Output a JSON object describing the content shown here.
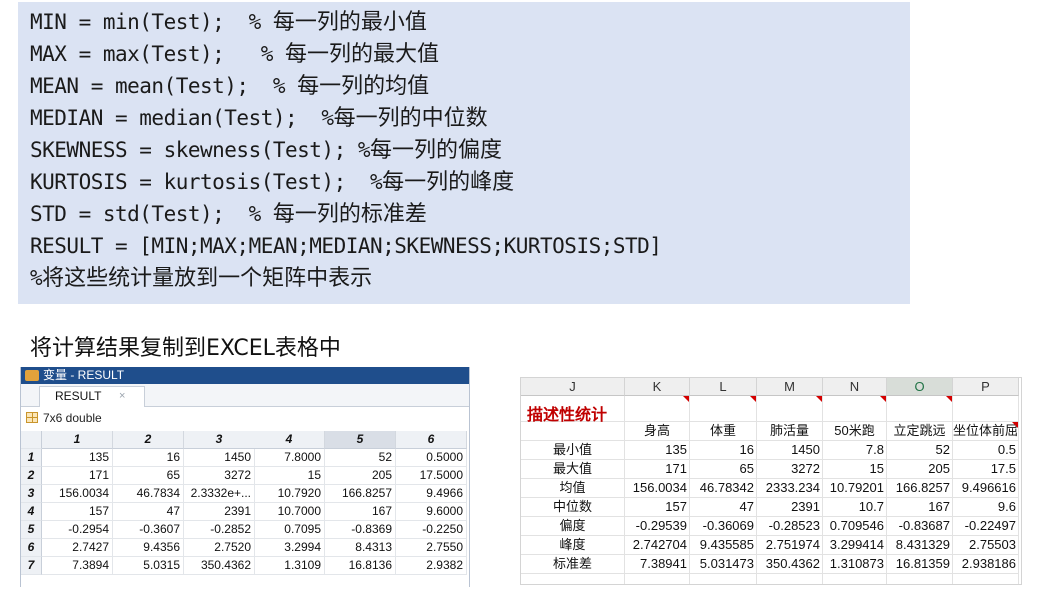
{
  "code_lines": [
    {
      "code": "MIN = min(Test);  % ",
      "comment": "每一列的最小值"
    },
    {
      "code": "MAX = max(Test);   % ",
      "comment": "每一列的最大值"
    },
    {
      "code": "MEAN = mean(Test);  % ",
      "comment": "每一列的均值"
    },
    {
      "code": "MEDIAN = median(Test);  %",
      "comment": "每一列的中位数"
    },
    {
      "code": "SKEWNESS = skewness(Test); %",
      "comment": "每一列的偏度"
    },
    {
      "code": "KURTOSIS = kurtosis(Test);  %",
      "comment": "每一列的峰度"
    },
    {
      "code": "STD = std(Test);  % ",
      "comment": "每一列的标准差"
    },
    {
      "code": "RESULT = [MIN;MAX;MEAN;MEDIAN;SKEWNESS;KURTOSIS;STD]",
      "comment": ""
    },
    {
      "code": "%",
      "comment": "将这些统计量放到一个矩阵中表示"
    }
  ],
  "caption": "将计算结果复制到EXCEL表格中",
  "matlab": {
    "window_title": "变量 - RESULT",
    "tab_label": "RESULT",
    "tab_close": "×",
    "dimension": "7x6 double",
    "col_headers": [
      "1",
      "2",
      "3",
      "4",
      "5",
      "6"
    ],
    "row_headers": [
      "1",
      "2",
      "3",
      "4",
      "5",
      "6",
      "7"
    ],
    "rows": [
      [
        "135",
        "16",
        "1450",
        "7.8000",
        "52",
        "0.5000"
      ],
      [
        "171",
        "65",
        "3272",
        "15",
        "205",
        "17.5000"
      ],
      [
        "156.0034",
        "46.7834",
        "2.3332e+...",
        "10.7920",
        "166.8257",
        "9.4966"
      ],
      [
        "157",
        "47",
        "2391",
        "10.7000",
        "167",
        "9.6000"
      ],
      [
        "-0.2954",
        "-0.3607",
        "-0.2852",
        "0.7095",
        "-0.8369",
        "-0.2250"
      ],
      [
        "2.7427",
        "9.4356",
        "2.7520",
        "3.2994",
        "8.4313",
        "2.7550"
      ],
      [
        "7.3894",
        "5.0315",
        "350.4362",
        "1.3109",
        "16.8136",
        "2.9382"
      ]
    ]
  },
  "excel": {
    "col_headers": [
      "J",
      "K",
      "L",
      "M",
      "N",
      "O",
      "P"
    ],
    "title": "描述性统计",
    "field_headers": [
      "身高",
      "体重",
      "肺活量",
      "50米跑",
      "立定跳远",
      "坐位体前屈"
    ],
    "row_labels": [
      "最小值",
      "最大值",
      "均值",
      "中位数",
      "偏度",
      "峰度",
      "标准差"
    ],
    "rows": [
      [
        "135",
        "16",
        "1450",
        "7.8",
        "52",
        "0.5"
      ],
      [
        "171",
        "65",
        "3272",
        "15",
        "205",
        "17.5"
      ],
      [
        "156.0034",
        "46.78342",
        "2333.234",
        "10.79201",
        "166.8257",
        "9.496616"
      ],
      [
        "157",
        "47",
        "2391",
        "10.7",
        "167",
        "9.6"
      ],
      [
        "-0.29539",
        "-0.36069",
        "-0.28523",
        "0.709546",
        "-0.83687",
        "-0.22497"
      ],
      [
        "2.742704",
        "9.435585",
        "2.751974",
        "3.299414",
        "8.431329",
        "2.75503"
      ],
      [
        "7.38941",
        "5.031473",
        "350.4362",
        "1.310873",
        "16.81359",
        "2.938186"
      ]
    ]
  }
}
